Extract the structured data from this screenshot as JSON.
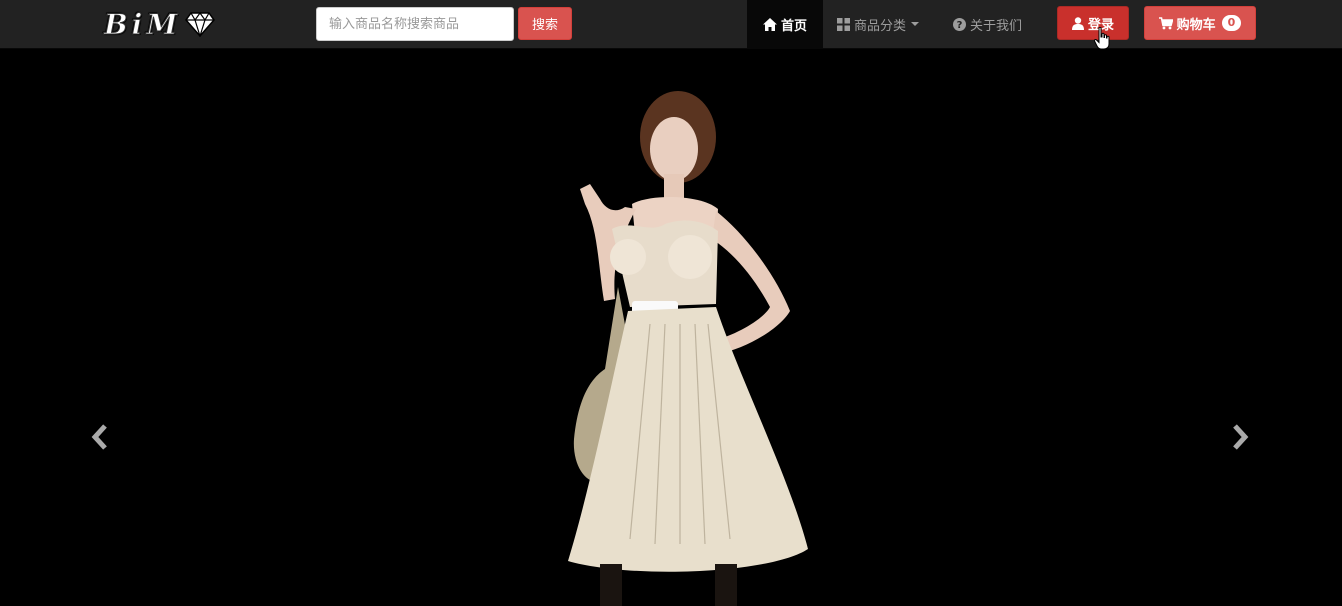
{
  "brand": {
    "letters": [
      "B",
      "i",
      "M"
    ],
    "icon": "diamond-icon"
  },
  "search": {
    "placeholder": "输入商品名称搜索商品",
    "button_label": "搜索"
  },
  "nav": {
    "home_label": "首页",
    "category_label": "商品分类",
    "about_label": "关于我们"
  },
  "actions": {
    "login_label": "登录",
    "cart_label": "购物车",
    "cart_count": "0"
  },
  "colors": {
    "navbar": "#222222",
    "accent": "#d9534f",
    "active": "#080808"
  },
  "carousel": {
    "icons": [
      "chevron-left-icon",
      "chevron-right-icon"
    ]
  }
}
